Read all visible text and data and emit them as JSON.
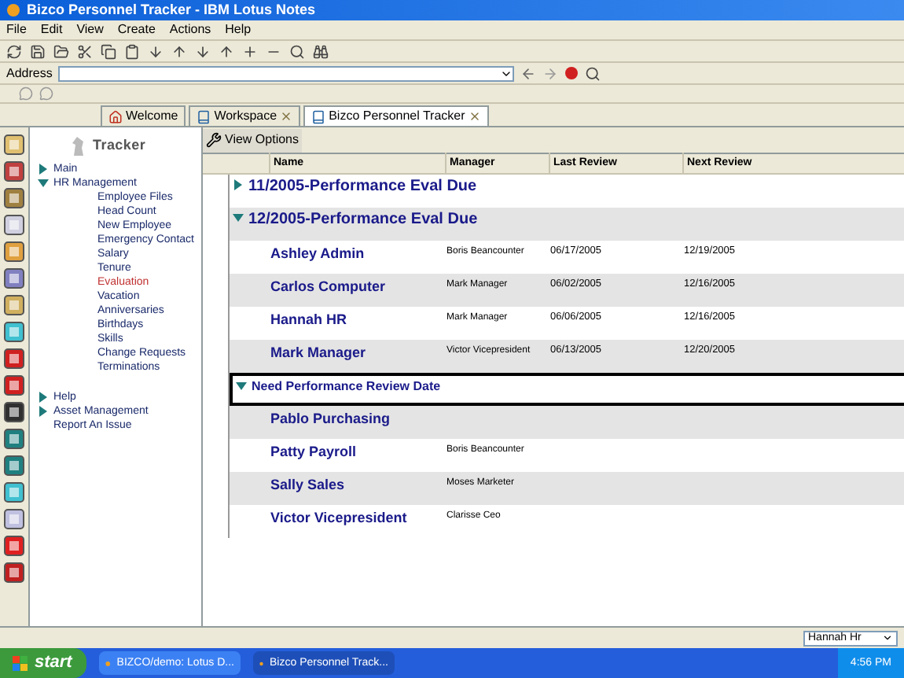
{
  "window": {
    "title": "Bizco Personnel Tracker - IBM Lotus Notes"
  },
  "menu": [
    "File",
    "Edit",
    "View",
    "Create",
    "Actions",
    "Help"
  ],
  "address_bar": {
    "label": "Address"
  },
  "tabs": [
    {
      "label": "Welcome",
      "selected": false,
      "closable": false
    },
    {
      "label": "Workspace",
      "selected": false,
      "closable": true
    },
    {
      "label": "Bizco Personnel Tracker",
      "selected": true,
      "closable": true
    }
  ],
  "navigator": {
    "title": "Tracker",
    "items": [
      {
        "label": "Main",
        "expanded": false,
        "selected": false
      },
      {
        "label": "HR Management",
        "expanded": true,
        "selected": false,
        "children": [
          {
            "label": "Employee Files",
            "selected": false
          },
          {
            "label": "Head Count",
            "selected": false
          },
          {
            "label": "New Employee",
            "selected": false
          },
          {
            "label": "Emergency Contact",
            "selected": false
          },
          {
            "label": "Salary",
            "selected": false
          },
          {
            "label": "Tenure",
            "selected": false
          },
          {
            "label": "Evaluation",
            "selected": true
          },
          {
            "label": "Vacation",
            "selected": false
          },
          {
            "label": "Anniversaries",
            "selected": false
          },
          {
            "label": "Birthdays",
            "selected": false
          },
          {
            "label": "Skills",
            "selected": false
          },
          {
            "label": "Change Requests",
            "selected": false
          },
          {
            "label": "Terminations",
            "selected": false
          }
        ]
      },
      {
        "label": "Help",
        "expanded": false,
        "selected": false
      },
      {
        "label": "Asset Management",
        "expanded": false,
        "selected": false
      },
      {
        "label": "Report An Issue",
        "selected": false
      }
    ]
  },
  "view": {
    "action": "View Options",
    "columns": [
      "Name",
      "Manager",
      "Last Review",
      "Next Review"
    ],
    "rows": [
      {
        "kind": "category",
        "label": "11/2005-Performance Eval Due",
        "expanded": false,
        "selected": false
      },
      {
        "kind": "category",
        "label": "12/2005-Performance Eval Due",
        "expanded": true,
        "selected": false
      },
      {
        "kind": "document",
        "name": "Ashley Admin",
        "manager": "Boris Beancounter",
        "last_review": "06/17/2005",
        "next_review": "12/19/2005"
      },
      {
        "kind": "document",
        "name": "Carlos Computer",
        "manager": "Mark Manager",
        "last_review": "06/02/2005",
        "next_review": "12/16/2005"
      },
      {
        "kind": "document",
        "name": "Hannah HR",
        "manager": "Mark Manager",
        "last_review": "06/06/2005",
        "next_review": "12/16/2005"
      },
      {
        "kind": "document",
        "name": "Mark Manager",
        "manager": "Victor Vicepresident",
        "last_review": "06/13/2005",
        "next_review": "12/20/2005"
      },
      {
        "kind": "category",
        "label": "Need Performance Review Date",
        "expanded": true,
        "selected": true
      },
      {
        "kind": "document",
        "name": "Pablo Purchasing"
      },
      {
        "kind": "document",
        "name": "Patty Payroll",
        "manager": "Boris Beancounter"
      },
      {
        "kind": "document",
        "name": "Sally Sales",
        "manager": "Moses Marketer"
      },
      {
        "kind": "document",
        "name": "Victor Vicepresident",
        "manager": "Clarisse Ceo"
      }
    ]
  },
  "status_bar": {
    "location": "Hannah Hr"
  },
  "taskbar": {
    "start": "start",
    "items": [
      {
        "label": "BIZCO/demo: Lotus D...",
        "selected": false
      },
      {
        "label": "Bizco Personnel Track...",
        "selected": true
      }
    ],
    "clock": "4:56 PM"
  }
}
